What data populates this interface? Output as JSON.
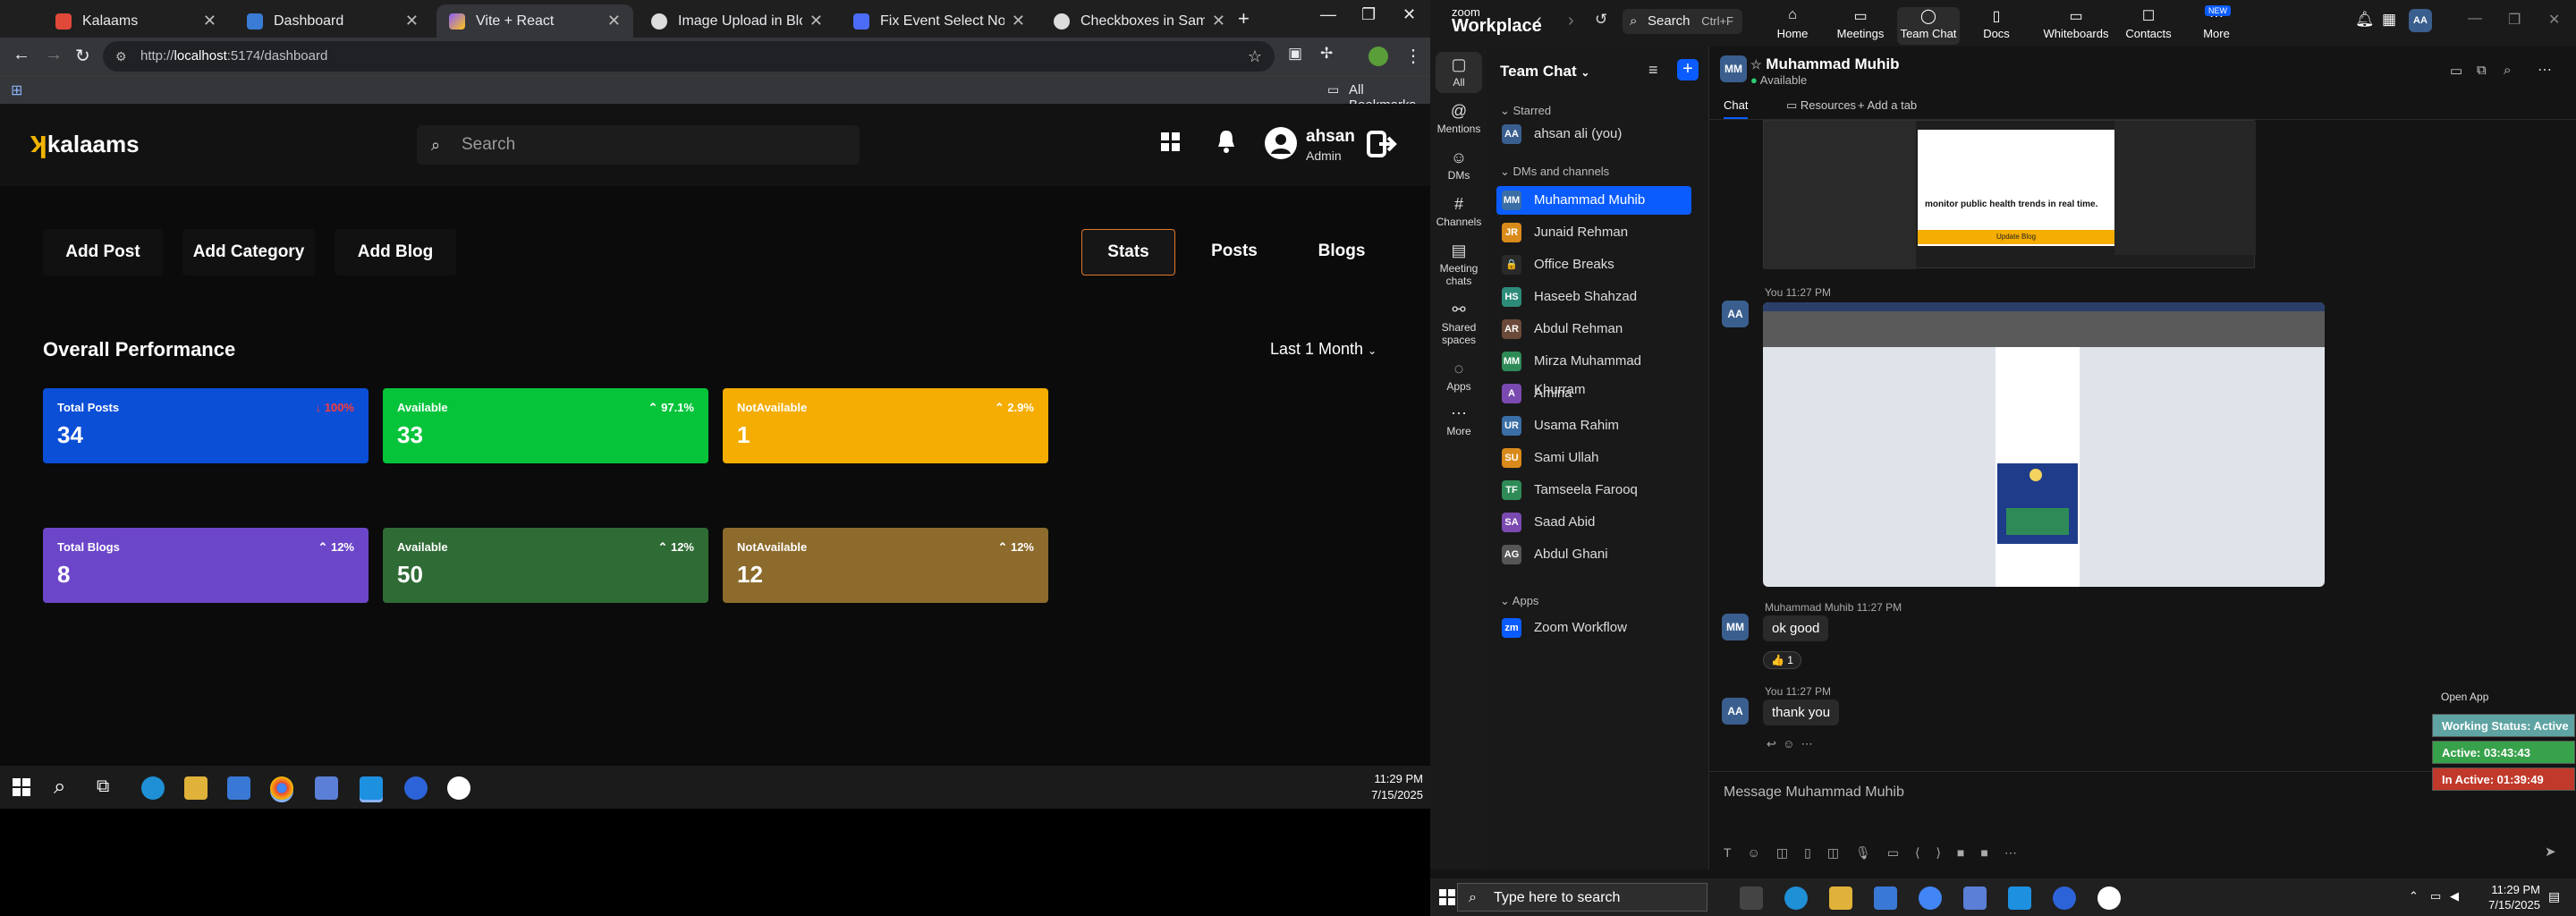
{
  "browser": {
    "tabs": [
      {
        "title": "Kalaams",
        "active": false
      },
      {
        "title": "Dashboard",
        "active": false
      },
      {
        "title": "Vite + React",
        "active": true
      },
      {
        "title": "Image Upload in Blog Editor",
        "active": false
      },
      {
        "title": "Fix Event Select Not Working",
        "active": false
      },
      {
        "title": "Checkboxes in Same Row",
        "active": false
      }
    ],
    "url_prefix": "http://",
    "url_host": "localhost",
    "url_rest": ":5174/dashboard",
    "all_bookmarks": "All Bookmarks"
  },
  "app": {
    "logo": "kalaams",
    "search_placeholder": "Search",
    "user": {
      "name": "ahsan",
      "role": "Admin"
    },
    "actions": [
      "Add Post",
      "Add Category",
      "Add Blog"
    ],
    "tabs": [
      "Stats",
      "Posts",
      "Blogs"
    ],
    "section_title": "Overall Performance",
    "period": "Last 1 Month",
    "post_cards": [
      {
        "label": "Total Posts",
        "value": "34",
        "change": "↓ 100%",
        "color": "#0b4fd6"
      },
      {
        "label": "Available",
        "value": "33",
        "change": "⌃ 97.1%",
        "color": "#05c43a"
      },
      {
        "label": "NotAvailable",
        "value": "1",
        "change": "⌃ 2.9%",
        "color": "#f4ad00"
      }
    ],
    "blog_cards": [
      {
        "label": "Total Blogs",
        "value": "8",
        "change": "⌃ 12%",
        "color": "#6c46c9"
      },
      {
        "label": "Available",
        "value": "50",
        "change": "⌃ 12%",
        "color": "#2f6b35"
      },
      {
        "label": "NotAvailable",
        "value": "12",
        "change": "⌃ 12%",
        "color": "#8c6b2c"
      }
    ]
  },
  "taskbar_left": {
    "time": "11:29 PM",
    "date": "7/15/2025"
  },
  "zoom": {
    "brand_top": "zoom",
    "brand": "Workplace",
    "search": "Search",
    "search_shortcut": "Ctrl+F",
    "nav": [
      "Home",
      "Meetings",
      "Team Chat",
      "Docs",
      "Whiteboards",
      "Contacts",
      "More"
    ],
    "new_badge": "NEW",
    "rail": [
      "All",
      "Mentions",
      "DMs",
      "Channels",
      "Meeting chats",
      "Shared spaces",
      "Apps",
      "More"
    ],
    "list_title": "Team Chat",
    "starred": "Starred",
    "starred_item": "ahsan ali (you)",
    "dms_section": "DMs and channels",
    "contacts": [
      {
        "name": "Muhammad Muhib",
        "initials": "MM",
        "color": "#3a6ea5"
      },
      {
        "name": "Junaid Rehman",
        "initials": "JR",
        "color": "#d98a1a"
      },
      {
        "name": "Office Breaks",
        "initials": "🔒",
        "color": "#2a2a2a"
      },
      {
        "name": "Haseeb Shahzad",
        "initials": "HS",
        "color": "#2e8b7a"
      },
      {
        "name": "Abdul Rehman",
        "initials": "AR",
        "color": "#6b4a3a"
      },
      {
        "name": "Mirza Muhammad Khurram",
        "initials": "MM",
        "color": "#2e8b57"
      },
      {
        "name": "Amina",
        "initials": "A",
        "color": "#7a4ab0"
      },
      {
        "name": "Usama Rahim",
        "initials": "UR",
        "color": "#3a6ea5"
      },
      {
        "name": "Sami Ullah",
        "initials": "SU",
        "color": "#d98a1a"
      },
      {
        "name": "Tamseela Farooq",
        "initials": "TF",
        "color": "#2e8b57"
      },
      {
        "name": "Saad Abid",
        "initials": "SA",
        "color": "#7a4ab0"
      },
      {
        "name": "Abdul Ghani",
        "initials": "AG",
        "color": "#555"
      }
    ],
    "apps_section": "Apps",
    "apps_item": "Zoom Workflow",
    "chat": {
      "name": "Muhammad Muhib",
      "status": "Available",
      "tabs": [
        "Chat",
        "Resources",
        "Add a tab"
      ],
      "msg1_meta": "You  11:27 PM",
      "msg2_sender": "Muhammad Muhib  11:27 PM",
      "msg2_text": "ok good",
      "reaction": "👍 1",
      "msg3_meta": "You  11:27 PM",
      "msg3_text": "thank you",
      "composer": "Message Muhammad Muhib",
      "preview_title": "monitor public health trends in real time.",
      "preview_button": "Update Blog"
    },
    "work_status": {
      "open_app": "Open App",
      "working": "Working Status: Active",
      "active": "Active: 03:43:43",
      "inactive": "In Active: 01:39:49"
    }
  },
  "taskbar_right": {
    "search": "Type here to search",
    "time": "11:29 PM",
    "date": "7/15/2025"
  }
}
